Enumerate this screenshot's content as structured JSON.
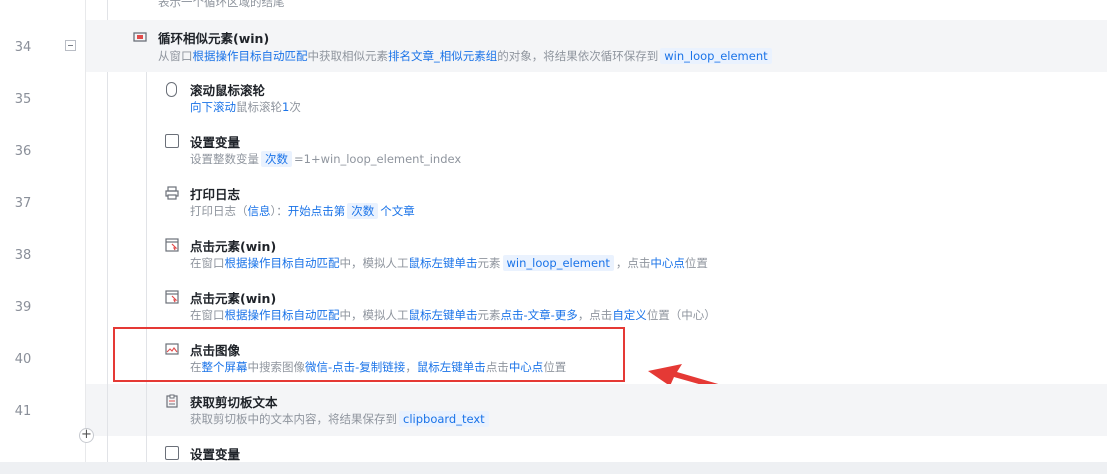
{
  "top_fragment": "表示一个循环区域的结尾",
  "loop_block": {
    "line": "34",
    "title": "循环相似元素(win)",
    "desc": {
      "p1": "从窗口",
      "h1": "根据操作目标自动匹配",
      "p2": "中获取相似元素",
      "h2": "排名文章_相似元素组",
      "p3": "的对象，将结果依次循环保存到",
      "tag": "win_loop_element"
    }
  },
  "rows": {
    "r35": {
      "line": "35",
      "title": "滚动鼠标滚轮",
      "h1": "向下滚动",
      "p1": "鼠标滚轮",
      "h2": "1",
      "p2": "次"
    },
    "r36": {
      "line": "36",
      "title": "设置变量",
      "p1": "设置整数变量",
      "tag": "次数",
      "p2": "=1+win_loop_element_index"
    },
    "r37": {
      "line": "37",
      "title": "打印日志",
      "p1": "打印日志（",
      "h1": "信息",
      "p2": "）：",
      "h2": "开始点击第",
      "tag": "次数",
      "h3": "个文章"
    },
    "r38": {
      "line": "38",
      "title": "点击元素(win)",
      "p1": "在窗口",
      "h1": "根据操作目标自动匹配",
      "p2": "中，模拟人工",
      "h2": "鼠标左键单击",
      "p3": "元素",
      "tag": "win_loop_element",
      "p4": "，点击",
      "h3": "中心点",
      "p5": "位置"
    },
    "r39": {
      "line": "39",
      "title": "点击元素(win)",
      "p1": "在窗口",
      "h1": "根据操作目标自动匹配",
      "p2": "中，模拟人工",
      "h2": "鼠标左键单击",
      "p3": "元素",
      "h3": "点击-文章-更多",
      "p4": "，点击",
      "h4": "自定义",
      "p5": "位置（中心）"
    },
    "r40": {
      "line": "40",
      "title": "点击图像",
      "p1": "在",
      "h1": "整个屏幕",
      "p2": "中搜索图像",
      "h2": "微信-点击-复制链接",
      "p3": "，",
      "h3": "鼠标左键单击",
      "p4": "点击",
      "h4": "中心点",
      "p5": "位置"
    },
    "r41": {
      "line": "41",
      "title": "获取剪切板文本",
      "p1": "获取剪切板中的文本内容，将结果保存到",
      "tag": "clipboard_text"
    },
    "r42": {
      "title": "设置变量"
    }
  },
  "colors": {
    "accent": "#1a73e8",
    "annotation_red": "#e53935"
  }
}
